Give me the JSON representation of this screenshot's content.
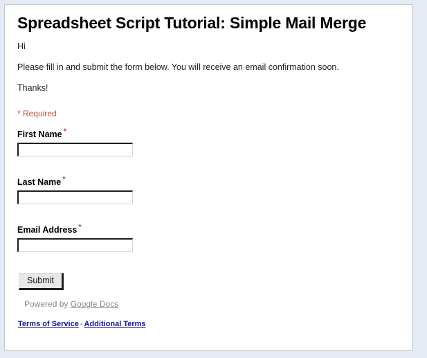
{
  "page": {
    "title": "Spreadsheet Script Tutorial: Simple Mail Merge",
    "intro_lines": [
      "Hi",
      "Please fill in and submit the form below.  You will receive an email confirmation soon.",
      "Thanks!"
    ],
    "required_note": "* Required"
  },
  "fields": [
    {
      "label": "First Name",
      "required_marker": "*",
      "value": "",
      "placeholder": ""
    },
    {
      "label": "Last Name",
      "required_marker": "*",
      "value": "",
      "placeholder": ""
    },
    {
      "label": "Email Address",
      "required_marker": "*",
      "value": "",
      "placeholder": ""
    }
  ],
  "actions": {
    "submit_label": "Submit"
  },
  "footer": {
    "powered_by_prefix": "Powered by ",
    "powered_by_link": "Google Docs",
    "terms_of_service": "Terms of Service",
    "separator": "-",
    "additional_terms": "Additional Terms"
  },
  "colors": {
    "page_background": "#e4ebf4",
    "card_background": "#ffffff",
    "card_border": "#c7c7c7",
    "required_red": "#bc4b39",
    "link_blue": "#12149c",
    "muted_grey": "#888888"
  }
}
